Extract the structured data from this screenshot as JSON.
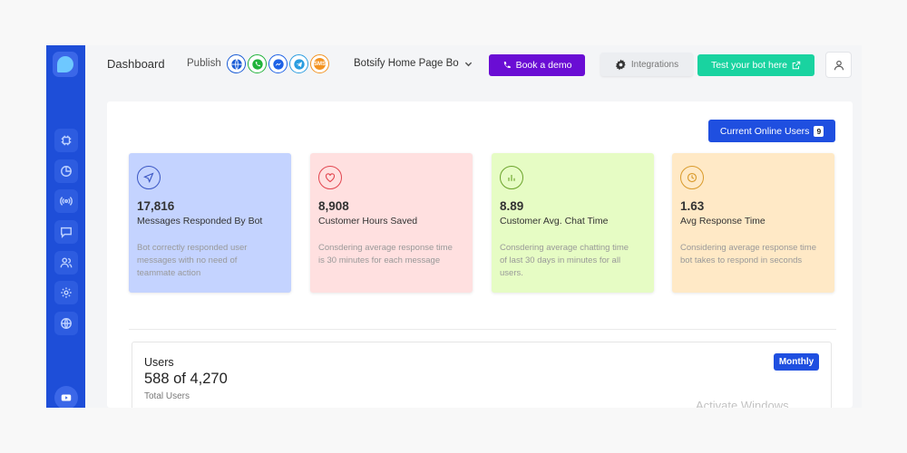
{
  "header": {
    "title": "Dashboard",
    "publish_label": "Publish",
    "channels": [
      {
        "name": "web-icon",
        "color": "#1a5cd6"
      },
      {
        "name": "whatsapp-icon",
        "color": "#21b33b"
      },
      {
        "name": "messenger-icon",
        "color": "#1e62e6"
      },
      {
        "name": "telegram-icon",
        "color": "#2a9de0"
      },
      {
        "name": "sms-icon",
        "color": "#f39321",
        "text": "SMS"
      }
    ],
    "bot_name": "Botsify Home Page Bo",
    "book_demo": "Book a demo",
    "integrations": "Integrations",
    "test_bot": "Test your bot here"
  },
  "online_users": {
    "label": "Current Online Users",
    "count": "9"
  },
  "cards": [
    {
      "value": "17,816",
      "label": "Messages Responded By Bot",
      "desc": "Bot correctly responded user messages with no need of teammate action",
      "bg": "#c4d3ff",
      "accent": "#3b57c4",
      "icon": "send-icon"
    },
    {
      "value": "8,908",
      "label": "Customer Hours Saved",
      "desc": "Consdering average response time is 30 minutes for each message",
      "bg": "#ffe0e0",
      "accent": "#e2454f",
      "icon": "heart-icon"
    },
    {
      "value": "8.89",
      "label": "Customer Avg. Chat Time",
      "desc": "Consdering average chatting time of last 30 days in minutes for all users.",
      "bg": "#e6fcc4",
      "accent": "#6aa32a",
      "icon": "bar-chart-icon"
    },
    {
      "value": "1.63",
      "label": "Avg Response Time",
      "desc": "Considering average response time bot takes to respond in seconds",
      "bg": "#ffe9c6",
      "accent": "#d99a2b",
      "icon": "clock-icon"
    }
  ],
  "users": {
    "title": "Users",
    "count": "588 of 4,270",
    "sub": "Total Users",
    "period": "Monthly"
  },
  "watermark": "Activate Windows"
}
